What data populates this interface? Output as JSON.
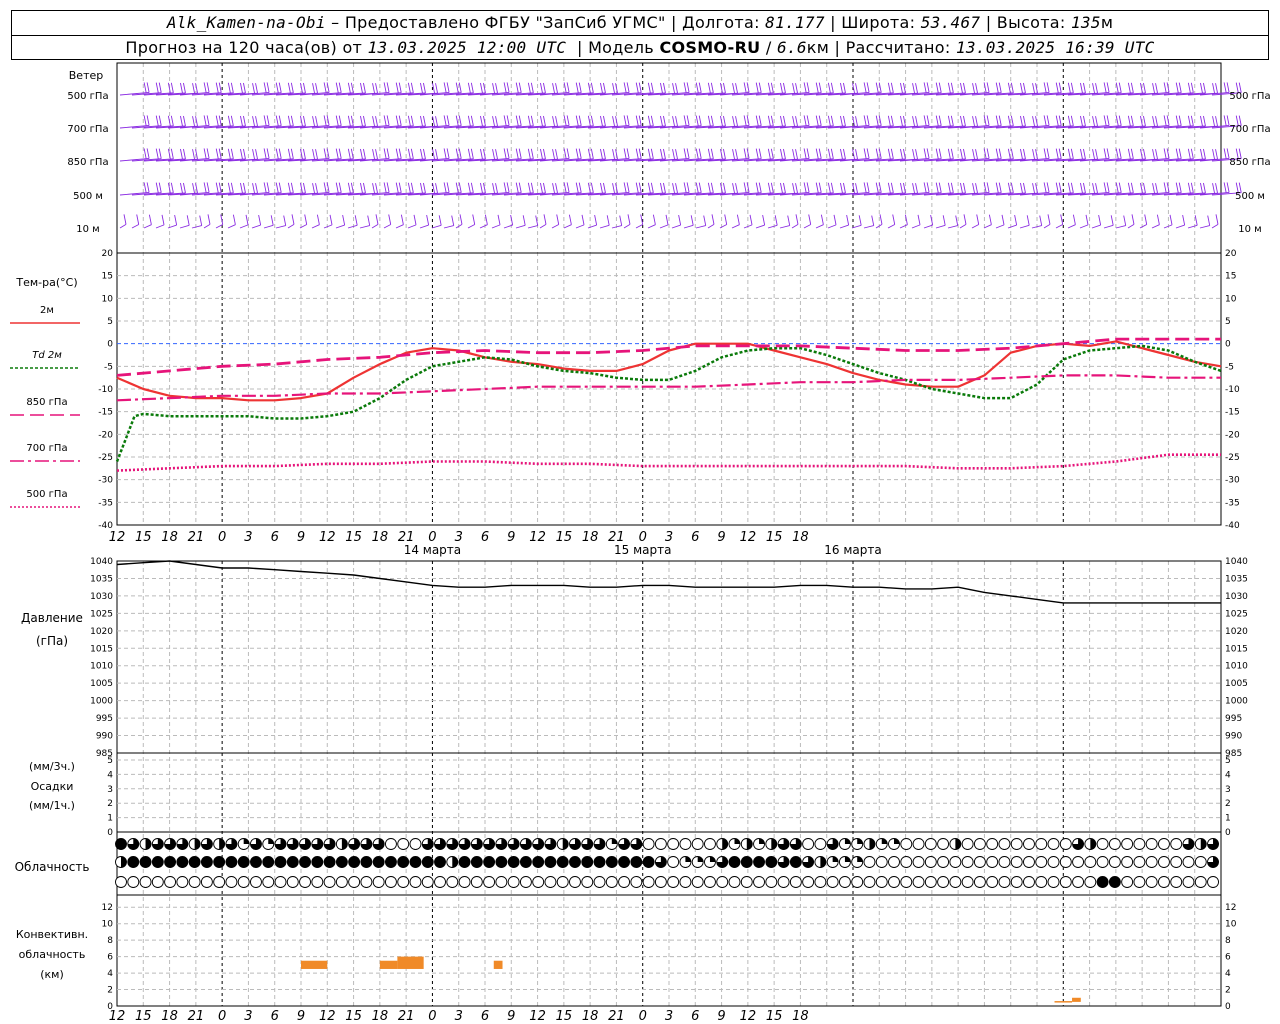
{
  "header": {
    "station": "Alk_Kamen-na-Obi",
    "provider": "– Предоставлено ФГБУ \"ЗапСиб УГМС\"",
    "lon_label": "Долгота:",
    "lon": "81.177",
    "lat_label": "Широта:",
    "lat": "53.467",
    "alt_label": "Высота:",
    "alt": "135",
    "alt_unit": "м",
    "forecast_label": "Прогноз на 120 часа(ов) от",
    "forecast_start": "13.03.2025 12:00 UTC",
    "model_label": "Модель",
    "model": "COSMO-RU",
    "resolution": "6.6",
    "res_unit": "км",
    "calc_label": "Рассчитано:",
    "calc_time": "13.03.2025 16:39 UTC"
  },
  "labels": {
    "wind": "Ветер",
    "wind_levels": [
      "500 гПа",
      "700 гПа",
      "850 гПа",
      "500 м",
      "10 м"
    ],
    "temp_title": "Тем-ра(°C)",
    "legend": [
      "2м",
      "Td 2м",
      "850 гПа",
      "700 гПа",
      "500 гПа"
    ],
    "pressure": [
      "Давление",
      "(гПа)"
    ],
    "precip": [
      "(мм/3ч.)",
      "Осадки",
      "(мм/1ч.)"
    ],
    "cloud": "Облачность",
    "conv": [
      "Конвективн.",
      "облачность",
      "(км)"
    ],
    "days": [
      "14 марта",
      "15 марта",
      "16 марта"
    ]
  },
  "colors": {
    "t2m": "#ee3333",
    "td2m": "#0a7a0a",
    "t850": "#e6147a",
    "t700": "#e6147a",
    "t500": "#e6147a",
    "pressure": "#000000",
    "wind": "#8a2be2",
    "conv": "#f08a28"
  },
  "chart_data": [
    {
      "type": "line",
      "title": "Тем-ра(°C)",
      "x_unit": "hours since 13.03.2025 12:00 UTC",
      "x_tick_labels": [
        "12",
        "15",
        "18",
        "21",
        "0",
        "3",
        "6",
        "9",
        "12",
        "15",
        "18",
        "21",
        "0",
        "3",
        "6",
        "9",
        "12",
        "15",
        "18",
        "21",
        "0",
        "3",
        "6",
        "9",
        "12",
        "15",
        "18"
      ],
      "ylim": [
        -40,
        20
      ],
      "y_ticks": [
        -40,
        -35,
        -30,
        -25,
        -20,
        -15,
        -10,
        -5,
        0,
        5,
        10,
        15,
        20
      ],
      "series": [
        {
          "name": "2м",
          "x": [
            0,
            3,
            6,
            9,
            12,
            15,
            18,
            21,
            24,
            27,
            30,
            33,
            36,
            39,
            42,
            45,
            48,
            51,
            54,
            57,
            60,
            63,
            66,
            69,
            72,
            75,
            78,
            81,
            84,
            87,
            90,
            93,
            96,
            99,
            102,
            105,
            108,
            111,
            114,
            117,
            120,
            123,
            126
          ],
          "y": [
            -7.5,
            -10,
            -11.5,
            -12,
            -12,
            -12.5,
            -12.5,
            -12,
            -11,
            -7.5,
            -4.5,
            -2,
            -1,
            -1.5,
            -3,
            -4,
            -4.5,
            -5.5,
            -6,
            -6,
            -4.5,
            -1.5,
            0,
            0,
            0,
            -1.5,
            -3,
            -4.5,
            -6.5,
            -8,
            -9,
            -9.5,
            -9.5,
            -7,
            -2,
            -0.5,
            0,
            -0.5,
            0.5,
            -1,
            -2.5,
            -4,
            -5
          ]
        },
        {
          "name": "Td 2м",
          "x": [
            0,
            1,
            2,
            3,
            6,
            9,
            12,
            15,
            18,
            21,
            24,
            27,
            30,
            33,
            36,
            39,
            42,
            45,
            48,
            51,
            54,
            57,
            60,
            63,
            66,
            69,
            72,
            75,
            78,
            81,
            84,
            87,
            90,
            93,
            96,
            99,
            102,
            105,
            108,
            111,
            114,
            117,
            120,
            123,
            126
          ],
          "y": [
            -26,
            -21,
            -16,
            -15.5,
            -16,
            -16,
            -16,
            -16,
            -16.5,
            -16.5,
            -16,
            -15,
            -12,
            -8,
            -5,
            -4,
            -3,
            -3.5,
            -5,
            -6,
            -6.5,
            -7.5,
            -8,
            -8,
            -6,
            -3,
            -1.5,
            -1,
            -1,
            -2.5,
            -4.5,
            -6.5,
            -8,
            -10,
            -11,
            -12,
            -12,
            -9,
            -3.5,
            -1.5,
            -1,
            -0.5,
            -1.5,
            -4,
            -6
          ]
        },
        {
          "name": "850 гПа",
          "x": [
            0,
            6,
            12,
            18,
            24,
            30,
            36,
            42,
            48,
            54,
            60,
            66,
            72,
            78,
            84,
            90,
            96,
            102,
            108,
            114,
            120,
            126
          ],
          "y": [
            -7,
            -6,
            -5,
            -4.5,
            -3.5,
            -3,
            -2,
            -1.5,
            -2,
            -2,
            -1.5,
            -0.5,
            -0.5,
            -0.5,
            -1,
            -1.5,
            -1.5,
            -1,
            0,
            1,
            1,
            1
          ]
        },
        {
          "name": "700 гПа",
          "x": [
            0,
            6,
            12,
            18,
            24,
            30,
            36,
            42,
            48,
            54,
            60,
            66,
            72,
            78,
            84,
            90,
            96,
            102,
            108,
            114,
            120,
            126
          ],
          "y": [
            -12.5,
            -12,
            -11.5,
            -11.5,
            -11,
            -11,
            -10.5,
            -10,
            -9.5,
            -9.5,
            -9.5,
            -9.5,
            -9,
            -8.5,
            -8.5,
            -8,
            -8,
            -7.5,
            -7,
            -7,
            -7.5,
            -7.5
          ]
        },
        {
          "name": "500 гПа",
          "x": [
            0,
            6,
            12,
            18,
            24,
            30,
            36,
            42,
            48,
            54,
            60,
            66,
            72,
            78,
            84,
            90,
            96,
            102,
            108,
            114,
            120,
            126
          ],
          "y": [
            -28,
            -27.5,
            -27,
            -27,
            -26.5,
            -26.5,
            -26,
            -26,
            -26.5,
            -26.5,
            -27,
            -27,
            -27,
            -27,
            -27,
            -27,
            -27.5,
            -27.5,
            -27,
            -26,
            -24.5,
            -24.5
          ]
        }
      ]
    },
    {
      "type": "line",
      "title": "Давление (гПа)",
      "x_unit": "hours since 13.03.2025 12:00 UTC",
      "ylim": [
        985,
        1040
      ],
      "y_ticks": [
        985,
        990,
        995,
        1000,
        1005,
        1010,
        1015,
        1020,
        1025,
        1030,
        1035,
        1040
      ],
      "series": [
        {
          "name": "Давление",
          "x": [
            0,
            3,
            6,
            9,
            12,
            15,
            18,
            21,
            24,
            27,
            30,
            33,
            36,
            39,
            42,
            45,
            48,
            51,
            54,
            57,
            60,
            63,
            66,
            69,
            72,
            75,
            78,
            81,
            84,
            87,
            90,
            93,
            96,
            99,
            102,
            105,
            108,
            111,
            114,
            117,
            120,
            123,
            126
          ],
          "y": [
            1039,
            1039.5,
            1040,
            1039,
            1038,
            1038,
            1037.5,
            1037,
            1036.5,
            1036,
            1035,
            1034,
            1033,
            1032.5,
            1032.5,
            1033,
            1033,
            1033,
            1032.5,
            1032.5,
            1033,
            1033,
            1032.5,
            1032.5,
            1032.5,
            1032.5,
            1033,
            1033,
            1032.5,
            1032.5,
            1032,
            1032,
            1032.5,
            1031,
            1030,
            1029,
            1028,
            1028,
            1028,
            1028,
            1028,
            1028,
            1028
          ]
        }
      ]
    },
    {
      "type": "bar",
      "title": "Осадки",
      "ylim": [
        0,
        5
      ],
      "y_ticks": [
        0,
        1,
        2,
        3,
        4,
        5
      ],
      "values": []
    },
    {
      "type": "table",
      "title": "Облачность",
      "legend": "0=clear,1=quarter,2=half,3=three-quarters,4=overcast",
      "rows": [
        [
          4,
          3,
          2,
          3,
          3,
          3,
          2,
          3,
          2,
          3,
          1,
          3,
          1,
          3,
          3,
          3,
          3,
          3,
          2,
          3,
          3,
          3,
          0,
          0,
          0,
          3,
          3,
          3,
          3,
          3,
          3,
          3,
          3,
          3,
          3,
          3,
          2,
          3,
          3,
          3,
          1,
          3,
          3,
          0,
          0,
          0,
          0,
          0,
          0,
          2,
          1,
          2,
          1,
          2,
          3,
          3,
          0,
          0,
          3,
          1,
          1,
          2,
          1,
          1,
          0,
          0,
          0,
          0,
          2,
          0,
          0,
          0,
          0,
          0,
          0,
          0,
          0,
          0,
          3,
          2,
          0,
          0,
          0,
          0,
          0,
          0,
          0,
          3,
          2,
          3
        ],
        [
          2,
          4,
          4,
          4,
          4,
          4,
          4,
          4,
          4,
          4,
          4,
          4,
          4,
          4,
          4,
          4,
          4,
          4,
          4,
          4,
          4,
          4,
          4,
          4,
          4,
          4,
          4,
          2,
          4,
          4,
          4,
          4,
          4,
          4,
          4,
          4,
          4,
          4,
          4,
          4,
          4,
          4,
          4,
          4,
          3,
          0,
          1,
          1,
          1,
          3,
          4,
          4,
          4,
          4,
          3,
          4,
          3,
          2,
          1,
          1,
          1,
          0,
          0,
          0,
          0,
          0,
          0,
          0,
          0,
          0,
          0,
          0,
          0,
          0,
          0,
          0,
          0,
          0,
          0,
          0,
          0,
          0,
          0,
          0,
          0,
          0,
          0,
          0,
          0,
          3
        ],
        [
          0,
          0,
          0,
          0,
          0,
          0,
          0,
          0,
          0,
          0,
          0,
          0,
          0,
          0,
          0,
          0,
          0,
          0,
          0,
          0,
          0,
          0,
          0,
          0,
          0,
          0,
          0,
          0,
          0,
          0,
          0,
          0,
          0,
          0,
          0,
          0,
          0,
          0,
          0,
          0,
          0,
          0,
          0,
          0,
          0,
          0,
          0,
          0,
          0,
          0,
          0,
          0,
          0,
          0,
          0,
          0,
          0,
          0,
          0,
          0,
          0,
          0,
          0,
          0,
          0,
          0,
          0,
          0,
          0,
          0,
          0,
          0,
          0,
          0,
          0,
          0,
          0,
          0,
          0,
          0,
          4,
          4,
          0,
          0,
          0,
          0,
          0,
          0,
          0,
          0
        ]
      ]
    },
    {
      "type": "bar",
      "title": "Конвективн. облачность (км)",
      "ylim": [
        0,
        13
      ],
      "y_ticks": [
        0,
        2,
        4,
        6,
        8,
        10,
        12
      ],
      "series": [
        {
          "name": "Конвективная облачность",
          "x_start": [
            21,
            30,
            32,
            43,
            107,
            109
          ],
          "x_end": [
            24,
            32,
            35,
            44,
            109,
            110
          ],
          "base_km": [
            4.5,
            4.5,
            4.5,
            4.5,
            0.5,
            0.5
          ],
          "top_km": [
            5.5,
            5.5,
            6,
            5.5,
            0.6,
            1
          ]
        }
      ]
    }
  ]
}
